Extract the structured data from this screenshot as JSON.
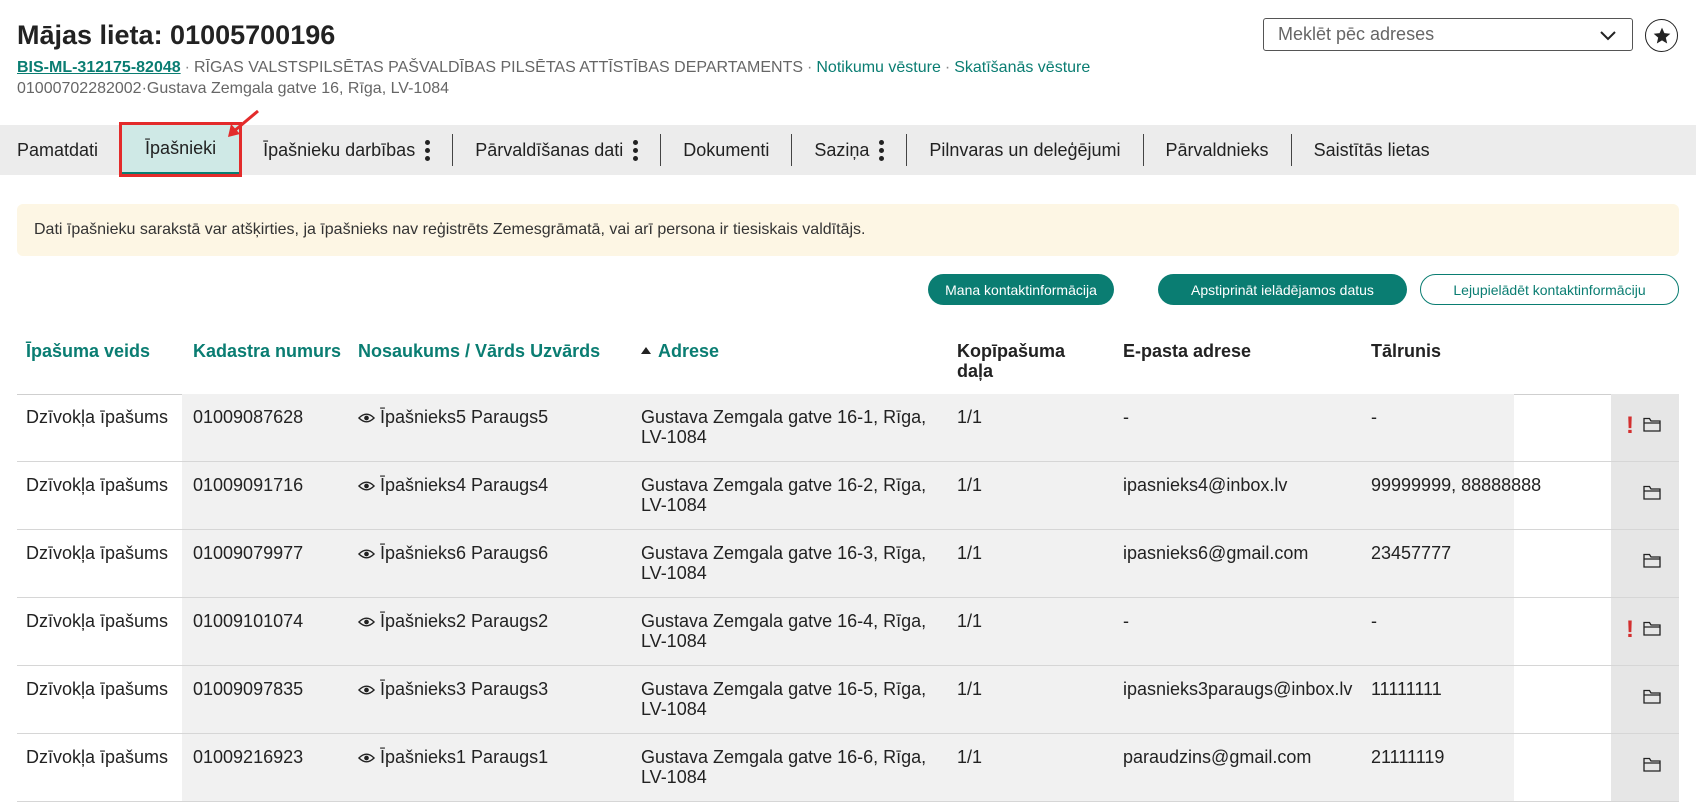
{
  "header": {
    "title": "Mājas lieta: 01005700196",
    "case_id": "BIS-ML-312175-82048",
    "department": "RĪGAS VALSTSPILSĒTAS PAŠVALDĪBAS PILSĒTAS ATTĪSTĪBAS DEPARTAMENTS",
    "events_link": "Notikumu vēsture",
    "views_link": "Skatīšanās vēsture",
    "separator": "·",
    "cadastre": "01000702282002",
    "address": "Gustava Zemgala gatve 16, Rīga, LV-1084"
  },
  "search": {
    "placeholder": "Meklēt pēc adreses"
  },
  "tabs": [
    {
      "label": "Pamatdati"
    },
    {
      "label": "Īpašnieki"
    },
    {
      "label": "Īpašnieku darbības"
    },
    {
      "label": "Pārvaldīšanas dati"
    },
    {
      "label": "Dokumenti"
    },
    {
      "label": "Saziņa"
    },
    {
      "label": "Pilnvaras un deleģējumi"
    },
    {
      "label": "Pārvaldnieks"
    },
    {
      "label": "Saistītās lietas"
    }
  ],
  "notice": "Dati īpašnieku sarakstā var atšķirties, ja īpašnieks nav reģistrēts Zemesgrāmatā, vai arī persona ir tiesiskais valdītājs.",
  "actions": {
    "my_contact": "Mana kontaktinformācija",
    "confirm_upload": "Apstiprināt ielādējamos datus",
    "download_contact": "Lejupielādēt kontaktinformāciju"
  },
  "table": {
    "headers": {
      "type": "Īpašuma veids",
      "cadastre": "Kadastra numurs",
      "name": "Nosaukums / Vārds Uzvārds",
      "address": "Adrese",
      "share_l1": "Kopīpašuma",
      "share_l2": "daļa",
      "email": "E-pasta adrese",
      "phone": "Tālrunis"
    },
    "rows": [
      {
        "type": "Dzīvokļa īpašums",
        "cadastre": "01009087628",
        "name": "Īpašnieks5 Paraugs5",
        "addr1": "Gustava Zemgala gatve 16-1, Rīga,",
        "addr2": "LV-1084",
        "share": "1/1",
        "email": "-",
        "phone": "-",
        "flag": "!"
      },
      {
        "type": "Dzīvokļa īpašums",
        "cadastre": "01009091716",
        "name": "Īpašnieks4 Paraugs4",
        "addr1": "Gustava Zemgala gatve 16-2, Rīga,",
        "addr2": "LV-1084",
        "share": "1/1",
        "email": "ipasnieks4@inbox.lv",
        "phone": "99999999, 88888888",
        "flag": ""
      },
      {
        "type": "Dzīvokļa īpašums",
        "cadastre": "01009079977",
        "name": "Īpašnieks6 Paraugs6",
        "addr1": "Gustava Zemgala gatve 16-3, Rīga,",
        "addr2": "LV-1084",
        "share": "1/1",
        "email": "ipasnieks6@gmail.com",
        "phone": "23457777",
        "flag": ""
      },
      {
        "type": "Dzīvokļa īpašums",
        "cadastre": "01009101074",
        "name": "Īpašnieks2 Paraugs2",
        "addr1": "Gustava Zemgala gatve 16-4, Rīga,",
        "addr2": "LV-1084",
        "share": "1/1",
        "email": "-",
        "phone": "-",
        "flag": "!"
      },
      {
        "type": "Dzīvokļa īpašums",
        "cadastre": "01009097835",
        "name": "Īpašnieks3 Paraugs3",
        "addr1": "Gustava Zemgala gatve 16-5, Rīga,",
        "addr2": "LV-1084",
        "share": "1/1",
        "email": "ipasnieks3paraugs@inbox.lv",
        "phone": "11111111",
        "flag": ""
      },
      {
        "type": "Dzīvokļa īpašums",
        "cadastre": "01009216923",
        "name": "Īpašnieks1 Paraugs1",
        "addr1": "Gustava Zemgala gatve 16-6, Rīga,",
        "addr2": "LV-1084",
        "share": "1/1",
        "email": "paraudzins@gmail.com",
        "phone": "21111119",
        "flag": ""
      }
    ]
  },
  "colors": {
    "accent": "#0a7d72",
    "highlight": "#e32b2b",
    "notice_bg": "#fdf6e4",
    "alert": "#d32f2f"
  },
  "icons": [
    "chevron-down-icon",
    "star-icon",
    "eye-icon",
    "folder-icon",
    "alert-icon",
    "arrow-annotation-icon"
  ]
}
